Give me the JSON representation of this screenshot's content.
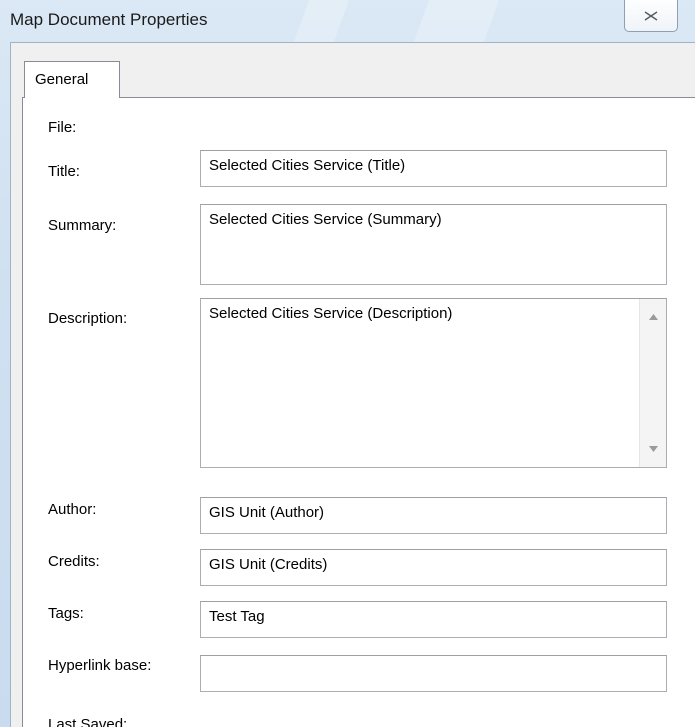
{
  "window": {
    "title": "Map Document Properties",
    "close_glyph": "✕"
  },
  "tabs": [
    {
      "label": "General",
      "selected": true
    }
  ],
  "general": {
    "file_label": "File:",
    "title_label": "Title:",
    "title_value": "Selected Cities Service (Title)",
    "summary_label": "Summary:",
    "summary_value": "Selected Cities Service (Summary)",
    "description_label": "Description:",
    "description_value": "Selected Cities Service (Description)",
    "author_label": "Author:",
    "author_value": "GIS Unit (Author)",
    "credits_label": "Credits:",
    "credits_value": "GIS Unit (Credits)",
    "tags_label": "Tags:",
    "tags_value": "Test Tag",
    "hyperlink_label": "Hyperlink base:",
    "hyperlink_value": "",
    "last_saved_label": "Last Saved:"
  },
  "icons": {
    "close": "close-icon",
    "scroll_up": "scroll-up-arrow-icon",
    "scroll_down": "scroll-down-arrow-icon"
  },
  "colors": {
    "titlebar": "#cfe0f1",
    "panel_background": "#ffffff",
    "field_border": "#abadb3"
  }
}
